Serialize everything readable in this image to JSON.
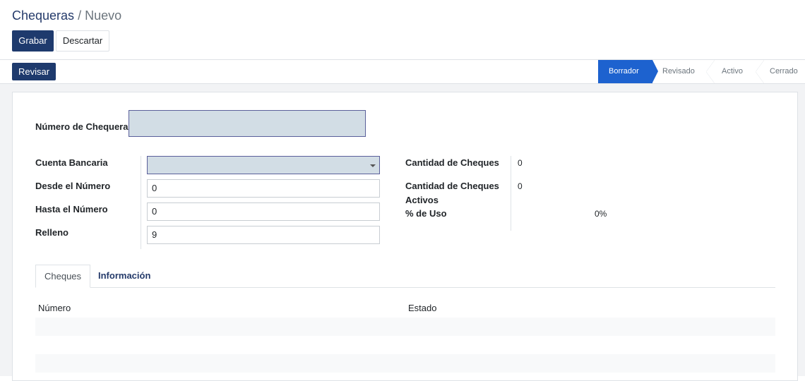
{
  "breadcrumb": {
    "parent": "Chequeras",
    "separator": "/",
    "current": "Nuevo"
  },
  "buttons": {
    "save": "Grabar",
    "discard": "Descartar",
    "review": "Revisar"
  },
  "status_steps": [
    {
      "label": "Borrador",
      "active": true
    },
    {
      "label": "Revisado",
      "active": false
    },
    {
      "label": "Activo",
      "active": false
    },
    {
      "label": "Cerrado",
      "active": false
    }
  ],
  "form": {
    "checkbook_number_label": "Número de Chequera",
    "checkbook_number_value": "",
    "bank_account_label": "Cuenta Bancaria",
    "bank_account_value": "",
    "from_number_label": "Desde el Número",
    "from_number_value": "0",
    "to_number_label": "Hasta el Número",
    "to_number_value": "0",
    "padding_label": "Relleno",
    "padding_value": "9",
    "check_count_label": "Cantidad de Cheques",
    "check_count_value": "0",
    "active_check_count_label_1": "Cantidad de Cheques",
    "active_check_count_label_2": "Activos",
    "active_check_count_value": "0",
    "usage_label": "% de Uso",
    "usage_value": "0%"
  },
  "tabs": [
    "Cheques",
    "Información"
  ],
  "table": {
    "columns": [
      "Número",
      "Estado"
    ]
  },
  "colors": {
    "primary": "#1e3a6d",
    "status_active": "#1d62cf",
    "required_field": "#d2dde5"
  }
}
